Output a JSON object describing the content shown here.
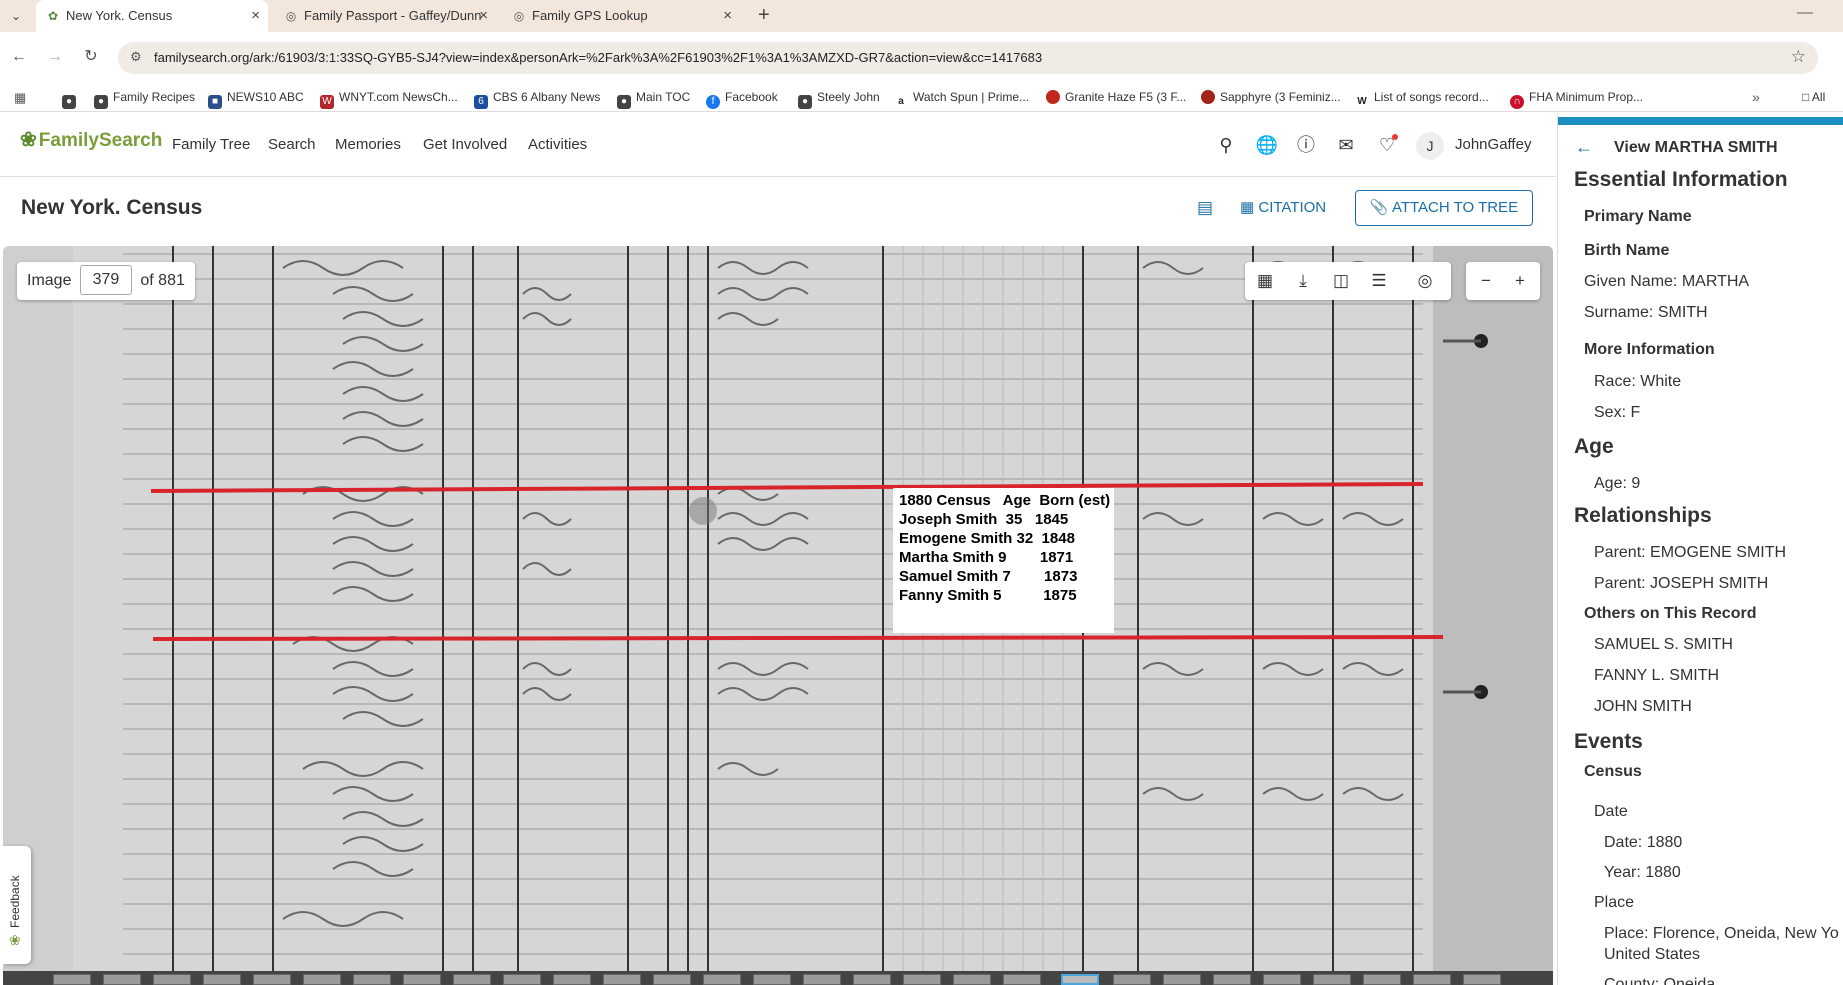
{
  "browser": {
    "tabs": [
      {
        "title": "New York. Census",
        "active": true
      },
      {
        "title": "Family Passport - Gaffey/Dunn",
        "active": false
      },
      {
        "title": "Family GPS Lookup",
        "active": false
      }
    ],
    "url": "familysearch.org/ark:/61903/3:1:33SQ-GYB5-SJ4?view=index&personArk=%2Fark%3A%2F61903%2F1%3A1%3AMZXD-GR7&action=view&cc=1417683",
    "bookmarks": [
      "Family Recipes",
      "NEWS10 ABC",
      "WNYT.com NewsCh...",
      "CBS 6 Albany News",
      "Main TOC",
      "Facebook",
      "Steely John",
      "Watch Spun | Prime...",
      "Granite Haze F5 (3 F...",
      "Sapphyre (3 Feminiz...",
      "List of songs record...",
      "FHA Minimum Prop..."
    ],
    "bookmarks_overflow": "All"
  },
  "header": {
    "logo": "FamilySearch",
    "nav": [
      "Family Tree",
      "Search",
      "Memories",
      "Get Involved",
      "Activities"
    ],
    "avatar_initial": "J",
    "username": "JohnGaffey"
  },
  "title_row": {
    "title": "New York. Census",
    "citation_label": "CITATION",
    "attach_label": "ATTACH TO TREE"
  },
  "viewer": {
    "image_label": "Image",
    "image_number": "379",
    "image_total": "of 881",
    "feedback_label": "Feedback",
    "overlay_lines": [
      "1880 Census   Age  Born (est)",
      "Joseph Smith  35   1845",
      "Emogene Smith 32  1848",
      "Martha Smith 9        1871",
      "Samuel Smith 7        1873",
      "Fanny Smith 5          1875"
    ]
  },
  "panel": {
    "title": "View MARTHA SMITH",
    "essential_heading": "Essential Information",
    "primary_name_heading": "Primary Name",
    "birth_name_heading": "Birth Name",
    "given_name": "Given Name: MARTHA",
    "surname": "Surname: SMITH",
    "more_info_heading": "More Information",
    "race": "Race: White",
    "sex": "Sex: F",
    "age_heading": "Age",
    "age": "Age: 9",
    "relationships_heading": "Relationships",
    "parent1": "Parent: EMOGENE SMITH",
    "parent2": "Parent: JOSEPH SMITH",
    "others_heading": "Others on This Record",
    "others": [
      "SAMUEL S. SMITH",
      "FANNY L. SMITH",
      "JOHN SMITH"
    ],
    "events_heading": "Events",
    "census_heading": "Census",
    "date_heading": "Date",
    "date": "Date: 1880",
    "year": "Year: 1880",
    "place_heading": "Place",
    "place_line1": "Place: Florence, Oneida, New Yo",
    "place_line2": "United States",
    "county_partial": "County: Oneida"
  },
  "colors": {
    "accent": "#1b6fa4",
    "brand_green": "#7a9e3a",
    "annotation_red": "#d8252b",
    "panel_bar": "#1a8fbf"
  }
}
